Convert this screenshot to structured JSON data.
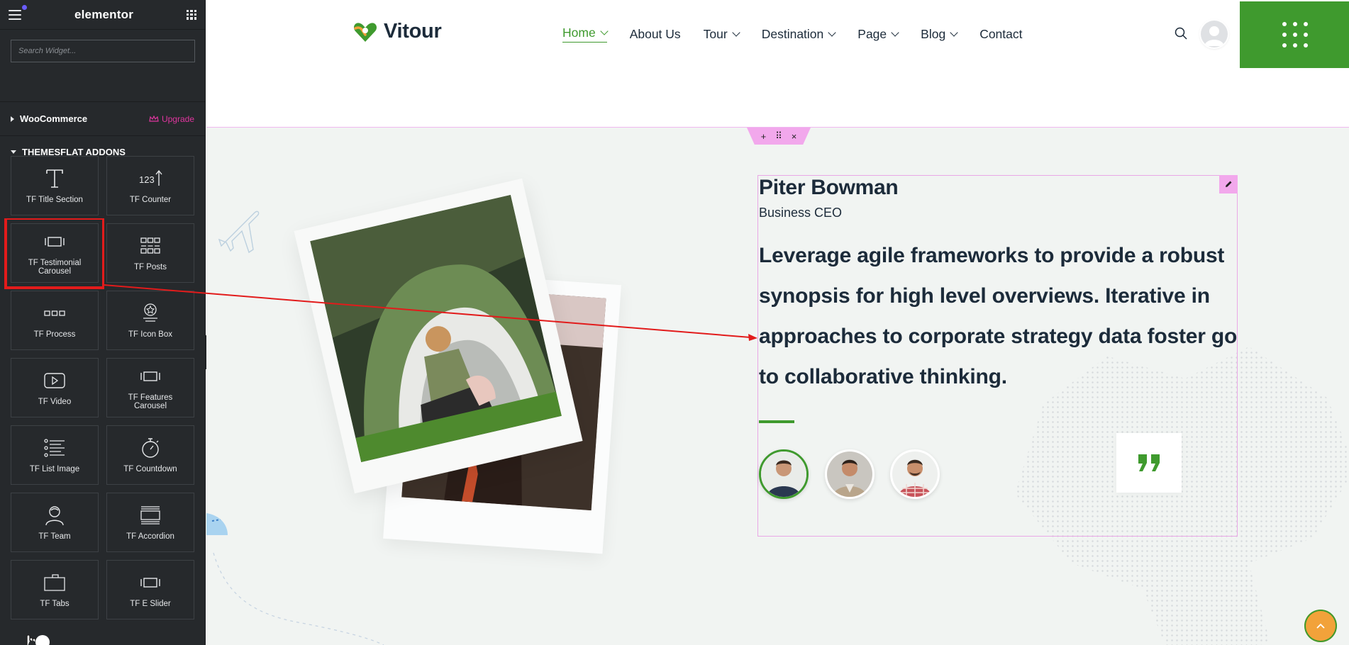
{
  "sidebar": {
    "brand": "elementor",
    "search_placeholder": "Search Widget...",
    "categories": [
      {
        "label": "WooCommerce",
        "badge": "Upgrade"
      },
      {
        "label": "THEMESFLAT ADDONS"
      }
    ],
    "widgets": [
      {
        "label": "TF Title Section",
        "icon": "title-icon"
      },
      {
        "label": "TF Counter",
        "icon": "counter-icon"
      },
      {
        "label": "TF Testimonial Carousel",
        "icon": "carousel-icon",
        "selected": true
      },
      {
        "label": "TF Posts",
        "icon": "posts-grid-icon"
      },
      {
        "label": "TF Process",
        "icon": "process-icon"
      },
      {
        "label": "TF Icon Box",
        "icon": "icon-box-icon"
      },
      {
        "label": "TF Video",
        "icon": "video-icon"
      },
      {
        "label": "TF Features Carousel",
        "icon": "carousel-icon"
      },
      {
        "label": "TF List Image",
        "icon": "list-icon"
      },
      {
        "label": "TF Countdown",
        "icon": "stopwatch-icon"
      },
      {
        "label": "TF Team",
        "icon": "person-icon"
      },
      {
        "label": "TF Accordion",
        "icon": "accordion-icon"
      },
      {
        "label": "TF Tabs",
        "icon": "tabs-icon"
      },
      {
        "label": "TF E Slider",
        "icon": "carousel-icon"
      }
    ]
  },
  "header": {
    "logo_text": "Vitour",
    "nav": [
      {
        "label": "Home",
        "dropdown": true,
        "active": true
      },
      {
        "label": "About Us",
        "dropdown": false
      },
      {
        "label": "Tour",
        "dropdown": true
      },
      {
        "label": "Destination",
        "dropdown": true
      },
      {
        "label": "Page",
        "dropdown": true
      },
      {
        "label": "Blog",
        "dropdown": true
      },
      {
        "label": "Contact",
        "dropdown": false
      }
    ]
  },
  "testimonial": {
    "name": "Piter Bowman",
    "role": "Business CEO",
    "quote": "Leverage agile frameworks to provide a robust synopsis for high level overviews. Iterative in approaches to corporate strategy data foster go to collaborative thinking."
  },
  "section_handle": {
    "add": "+",
    "move": "⠿",
    "close": "×"
  },
  "colors": {
    "brand_green": "#3f9a2e",
    "dark_text": "#1c2b3a",
    "sidebar_bg": "#26292c",
    "editor_pink": "#f2a8ec",
    "annotation_red": "#e21b1b"
  }
}
